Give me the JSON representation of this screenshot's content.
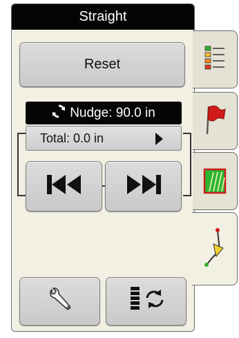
{
  "title": "Straight",
  "reset_label": "Reset",
  "nudge": "Nudge: 90.0 in",
  "total": "Total: 0.0 in",
  "icons": {
    "nudge": "refresh-icon",
    "total_arrow": "play-arrow-icon",
    "prev": "skip-back-icon",
    "next": "skip-forward-icon",
    "settings": "wrench-icon",
    "cycle": "list-cycle-icon",
    "tab1": "checklist-icon",
    "tab2": "flag-icon",
    "tab3": "field-rows-icon",
    "tab4": "guidance-path-icon"
  },
  "colors": {
    "title_bar": "#050505",
    "panel": "#f2f0e3",
    "flag": "#d11a1a",
    "field_green": "#2fb52f"
  }
}
